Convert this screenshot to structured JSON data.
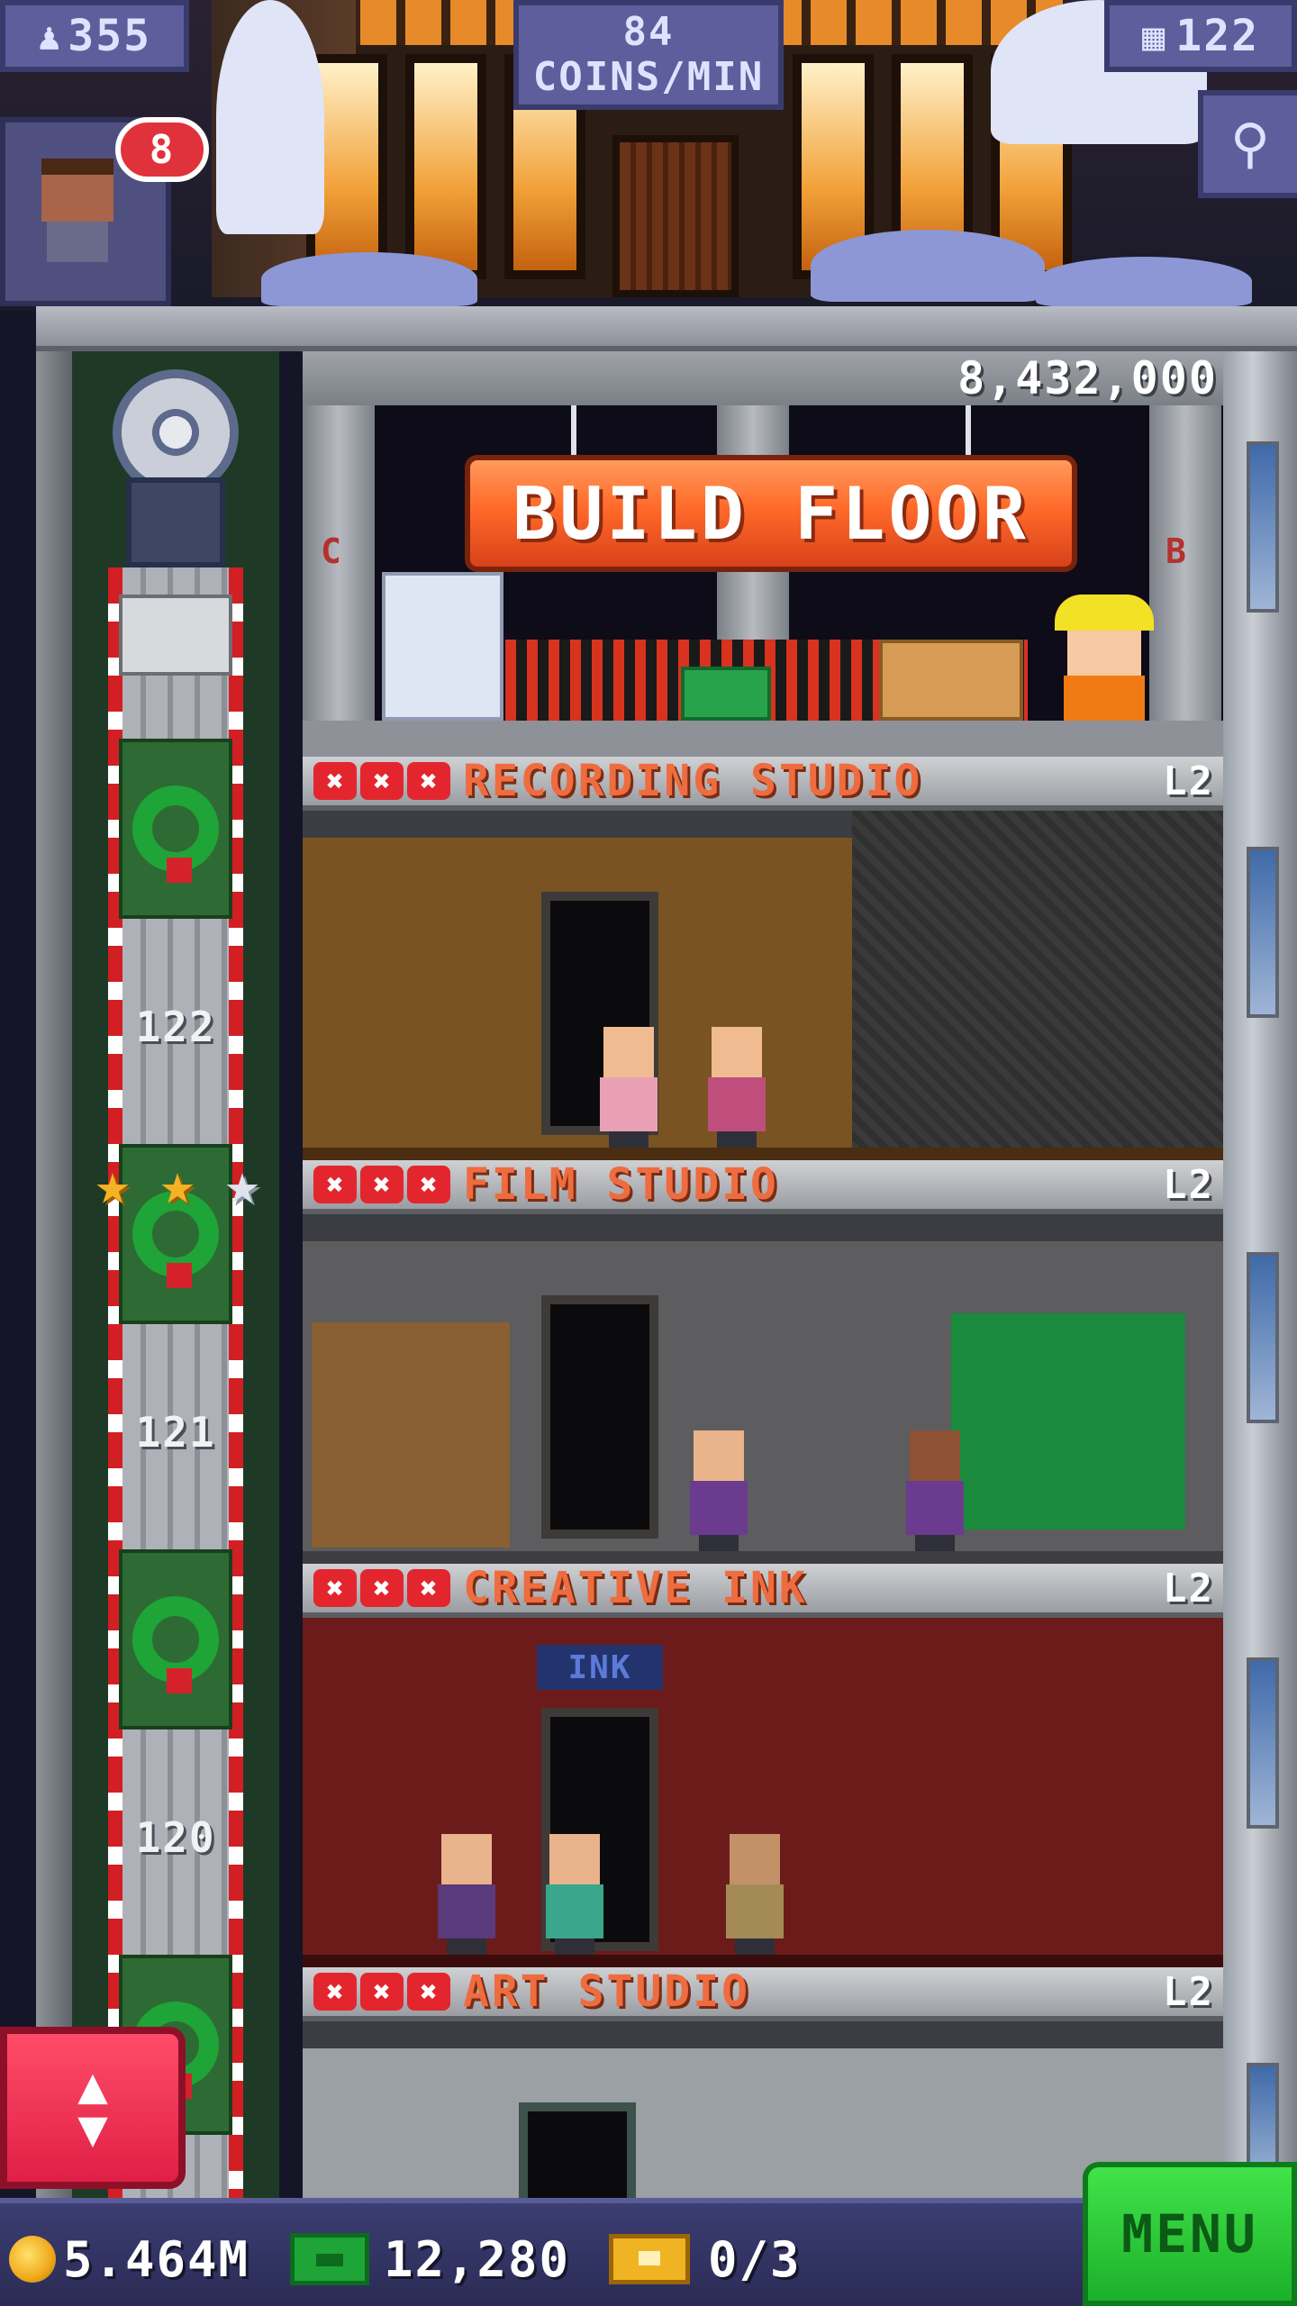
{
  "hud": {
    "population": "355",
    "coins_per_min_value": "84",
    "coins_per_min_label": "COINS/MIN",
    "floors": "122",
    "notifications": "8"
  },
  "build_floor": {
    "cost": "8,432,000",
    "button_label": "BUILD FLOOR",
    "left_letter": "C",
    "right_letter": "B"
  },
  "elevator": {
    "floor_numbers": [
      "122",
      "121",
      "120"
    ],
    "stars": [
      "gold",
      "gold",
      "silver"
    ]
  },
  "floors": [
    {
      "name": "RECORDING STUDIO",
      "level": "L2",
      "stock_marks": 3
    },
    {
      "name": "FILM STUDIO",
      "level": "L2",
      "stock_marks": 3
    },
    {
      "name": "CREATIVE INK",
      "level": "L2",
      "stock_marks": 3,
      "sign": "INK"
    },
    {
      "name": "ART STUDIO",
      "level": "L2",
      "stock_marks": 3
    }
  ],
  "resources": {
    "coins": "5.464M",
    "bux": "12,280",
    "tickets": "0/3"
  },
  "menu_label": "MENU",
  "icons": {
    "population": "person-icon",
    "floors": "building-icon",
    "search": "magnifier-icon",
    "coin": "coin-icon",
    "bux": "bux-icon",
    "ticket": "ticket-icon",
    "elevator_control": "up-down-arrows-icon"
  },
  "colors": {
    "floor_name": "#ee6c3f",
    "build_button": "#ff6a2a",
    "menu_button": "#2cc838",
    "elevator_button": "#e8284f",
    "stock_mark": "#e3262e"
  }
}
